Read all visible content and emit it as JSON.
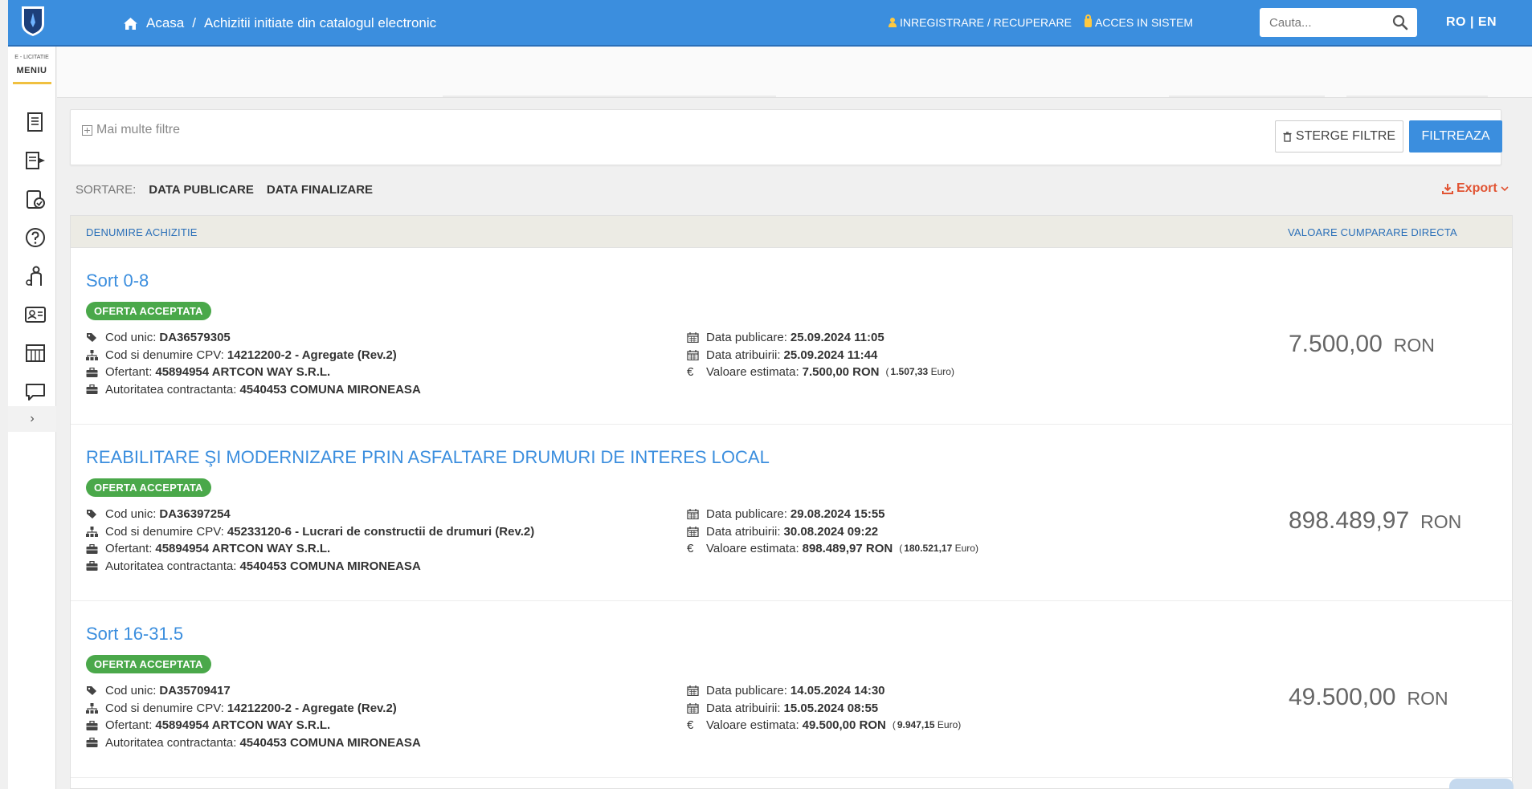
{
  "header": {
    "breadcrumb": {
      "home": "Acasa",
      "separator": "/",
      "current": "Achizitii initiate din catalogul electronic"
    },
    "auth": {
      "register": "INREGISTRARE / RECUPERARE",
      "login": "ACCES IN SISTEM"
    },
    "search": {
      "placeholder": "Cauta..."
    },
    "lang": "RO | EN"
  },
  "sidebar": {
    "brand": "E - LICITATIE",
    "menu_label": "MENIU",
    "items": [
      "documents-icon",
      "notices-icon",
      "clipboard-check-icon",
      "help-icon",
      "person-icon",
      "id-card-icon",
      "catalog-icon",
      "chat-icon"
    ],
    "toggle": "›"
  },
  "filters": {
    "more_filters": "Mai multe filtre",
    "clear_label": "STERGE FILTRE",
    "filter_label": "FILTREAZA"
  },
  "sort": {
    "label": "SORTARE:",
    "options": [
      "DATA PUBLICARE",
      "DATA FINALIZARE"
    ]
  },
  "export": {
    "label": "Export"
  },
  "table": {
    "col_name": "DENUMIRE ACHIZITIE",
    "col_value": "VALOARE CUMPARARE DIRECTA",
    "labels": {
      "cod_unic": "Cod unic:",
      "cpv": "Cod si denumire CPV:",
      "ofertant": "Ofertant:",
      "autoritate": "Autoritatea contractanta:",
      "data_publicare": "Data publicare:",
      "data_atribuire": "Data atribuirii:",
      "valoare_estimata": "Valoare estimata:"
    },
    "rows": [
      {
        "title": "Sort 0-8",
        "status": "OFERTA ACCEPTATA",
        "cod_unic": "DA36579305",
        "cpv": "14212200-2 - Agregate (Rev.2)",
        "ofertant": "45894954 ARTCON WAY S.R.L.",
        "autoritate": "4540453 COMUNA MIRONEASA",
        "data_publicare": "25.09.2024 11:05",
        "data_atribuire": "25.09.2024 11:44",
        "valoare_estimata": "7.500,00  RON",
        "valoare_euro": "1.507,33",
        "euro_label": "Euro",
        "amount": "7.500,00",
        "currency": "RON"
      },
      {
        "title": "REABILITARE ŞI MODERNIZARE PRIN ASFALTARE DRUMURI DE INTERES LOCAL",
        "status": "OFERTA ACCEPTATA",
        "cod_unic": "DA36397254",
        "cpv": "45233120-6 - Lucrari de constructii de drumuri (Rev.2)",
        "ofertant": "45894954 ARTCON WAY S.R.L.",
        "autoritate": "4540453 COMUNA MIRONEASA",
        "data_publicare": "29.08.2024 15:55",
        "data_atribuire": "30.08.2024 09:22",
        "valoare_estimata": "898.489,97  RON",
        "valoare_euro": "180.521,17",
        "euro_label": "Euro",
        "amount": "898.489,97",
        "currency": "RON"
      },
      {
        "title": "Sort 16-31.5",
        "status": "OFERTA ACCEPTATA",
        "cod_unic": "DA35709417",
        "cpv": "14212200-2 - Agregate (Rev.2)",
        "ofertant": "45894954 ARTCON WAY S.R.L.",
        "autoritate": "4540453 COMUNA MIRONEASA",
        "data_publicare": "14.05.2024 14:30",
        "data_atribuire": "15.05.2024 08:55",
        "valoare_estimata": "49.500,00  RON",
        "valoare_euro": "9.947,15",
        "euro_label": "Euro",
        "amount": "49.500,00",
        "currency": "RON"
      }
    ]
  },
  "colors": {
    "primary": "#3b8ede",
    "accepted": "#4aa84a",
    "export": "#e15433",
    "table_header_bg": "#ecebe4"
  }
}
